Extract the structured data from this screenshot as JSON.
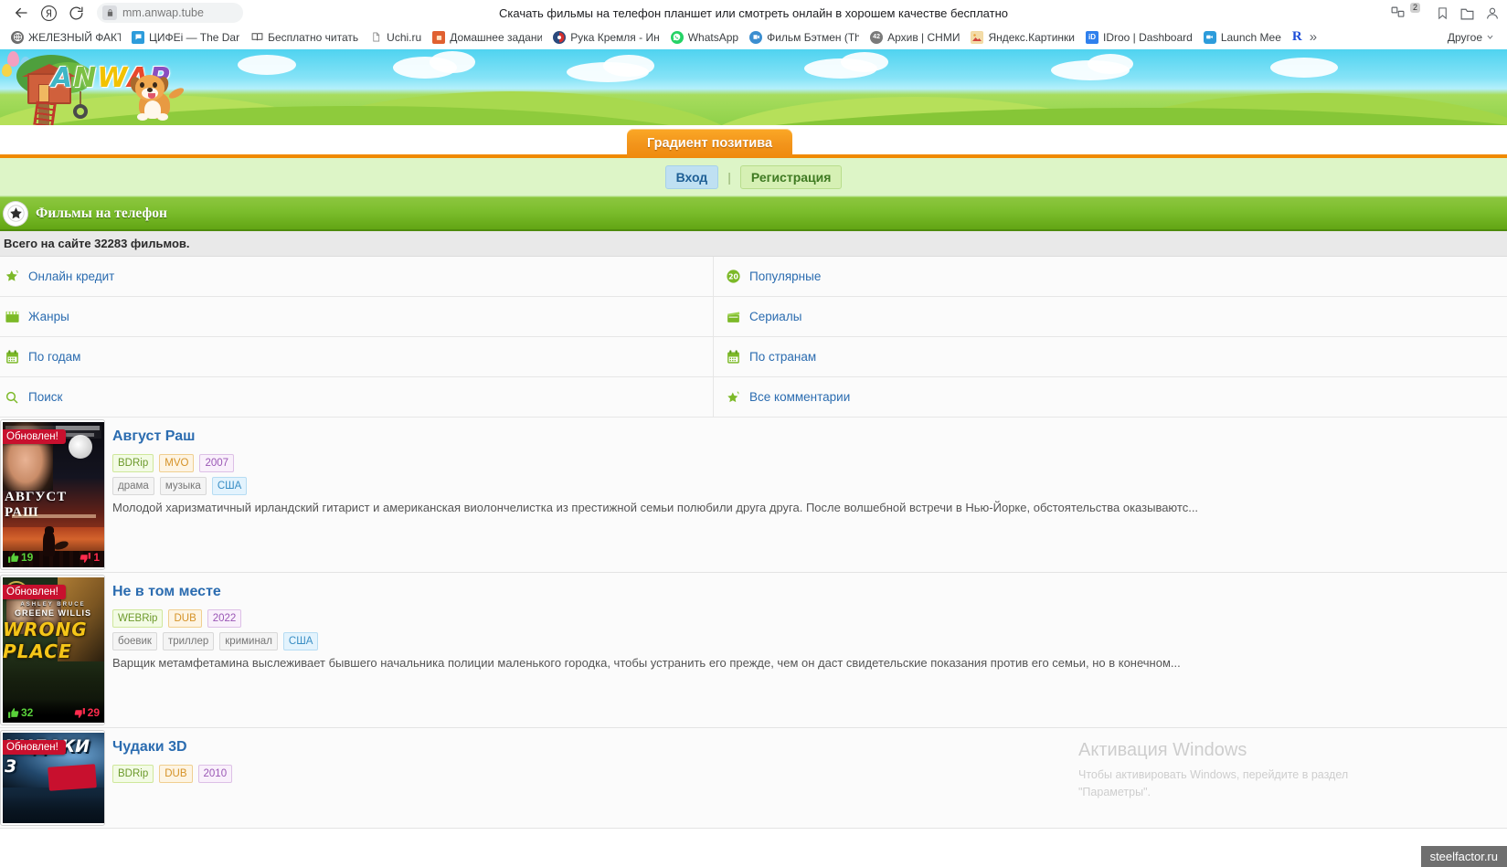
{
  "browser": {
    "page_title": "Скачать фильмы на телефон планшет или смотреть онлайн в хорошем качестве бесплатно",
    "url": "mm.anwap.tube",
    "back_icon": "back-arrow-icon",
    "yandex_icon": "yandex-logo-icon",
    "reload_icon": "reload-icon",
    "lock_icon": "lock-icon",
    "extension_badge_count": "2",
    "bookmarks": [
      {
        "label": "ЖЕЛЕЗНЫЙ ФАКТ",
        "icon": "globe-icon",
        "color": "#6d6d6d"
      },
      {
        "label": "ЦИФЕi — The Dar",
        "icon": "chat-icon",
        "color": "#2d9cdb"
      },
      {
        "label": "Бесплатно читать",
        "icon": "book-icon",
        "color": "#4a4a4a"
      },
      {
        "label": "Uchi.ru",
        "icon": "page-icon",
        "color": "#8a8a8a"
      },
      {
        "label": "Домашнее задани",
        "icon": "backpack-icon",
        "color": "#e06030"
      },
      {
        "label": "Рука Кремля - Ин",
        "icon": "flag-icon",
        "color": "#2b4a7d"
      },
      {
        "label": "WhatsApp",
        "icon": "whatsapp-icon",
        "color": "#25d366"
      },
      {
        "label": "Фильм Бэтмен (Th",
        "icon": "video-icon",
        "color": "#3b8ed0"
      },
      {
        "label": "Архив | СНМИ",
        "icon": "number-42-icon",
        "color": "#7a7a7a"
      },
      {
        "label": "Яндекс.Картинки",
        "icon": "image-icon",
        "color": "#e8a23b"
      },
      {
        "label": "IDroo | Dashboard",
        "icon": "idroo-icon",
        "color": "#2f80ed"
      },
      {
        "label": "Launch Mee",
        "icon": "camera-icon",
        "color": "#2d9cdb"
      },
      {
        "label": "R",
        "icon": "letter-r-icon",
        "color": "#1d4ed8"
      }
    ],
    "overflow_label": "»",
    "other_bookmarks_label": "Другое"
  },
  "site": {
    "logo_letters": [
      "A",
      "N",
      "W",
      "A",
      "P"
    ],
    "tab_label": "Градиент позитива",
    "login_label": "Вход",
    "separator": "|",
    "register_label": "Регистрация",
    "section_title": "Фильмы на телефон",
    "total_text": "Всего на сайте 32283 фильмов.",
    "nav_left": [
      {
        "label": "Онлайн кредит",
        "icon": "star-speech-icon"
      },
      {
        "label": "Жанры",
        "icon": "clapper-icon"
      },
      {
        "label": "По годам",
        "icon": "calendar-icon"
      },
      {
        "label": "Поиск",
        "icon": "search-icon"
      }
    ],
    "nav_right": [
      {
        "label": "Популярные",
        "icon": "top20-icon"
      },
      {
        "label": "Сериалы",
        "icon": "clapperboard-icon"
      },
      {
        "label": "По странам",
        "icon": "calendar-icon"
      },
      {
        "label": "Все комментарии",
        "icon": "comment-star-icon"
      }
    ],
    "updated_badge": "Обновлен!",
    "movies": [
      {
        "title": "Август Раш",
        "poster_title": "АВГУСТ РАШ",
        "quality": "BDRip",
        "voice": "MVO",
        "year": "2007",
        "genres": [
          "драма",
          "музыка"
        ],
        "country": "США",
        "likes": "19",
        "dislikes": "1",
        "description": "Молодой харизматичный ирландский гитарист и американская виолончелистка из престижной семьи полюбили друга друга. После волшебной встречи в Нью-Йорке, обстоятельства оказываютс..."
      },
      {
        "title": "Не в том месте",
        "poster_title": "WRONG PLACE",
        "quality": "WEBRip",
        "voice": "DUB",
        "year": "2022",
        "genres": [
          "боевик",
          "триллер",
          "криминал"
        ],
        "country": "США",
        "likes": "32",
        "dislikes": "29",
        "description": "Варщик метамфетамина выслеживает бывшего начальника полиции маленького городка, чтобы устранить его прежде, чем он даст свидетельские показания против его семьи, но в конечном..."
      },
      {
        "title": "Чудаки 3D",
        "poster_title": "ЧУДАКИ 3",
        "quality": "BDRip",
        "voice": "DUB",
        "year": "2010",
        "genres": [],
        "country": "",
        "likes": "",
        "dislikes": "",
        "description": ""
      }
    ],
    "poster_credits": {
      "movie2_actors_top": "ASHLEY   BRUCE",
      "movie2_actors_names": "GREENE   WILLIS"
    }
  },
  "watermarks": {
    "windows_line1": "Активация Windows",
    "windows_line2": "Чтобы активировать Windows, перейдите в раздел",
    "windows_line3": "\"Параметры\".",
    "steelfactor": "steelfactor.ru"
  },
  "colors": {
    "accent_orange": "#f2941b",
    "accent_green": "#7bbd2c",
    "link_blue": "#2b6cb0",
    "ribbon_red": "#c8102e"
  }
}
